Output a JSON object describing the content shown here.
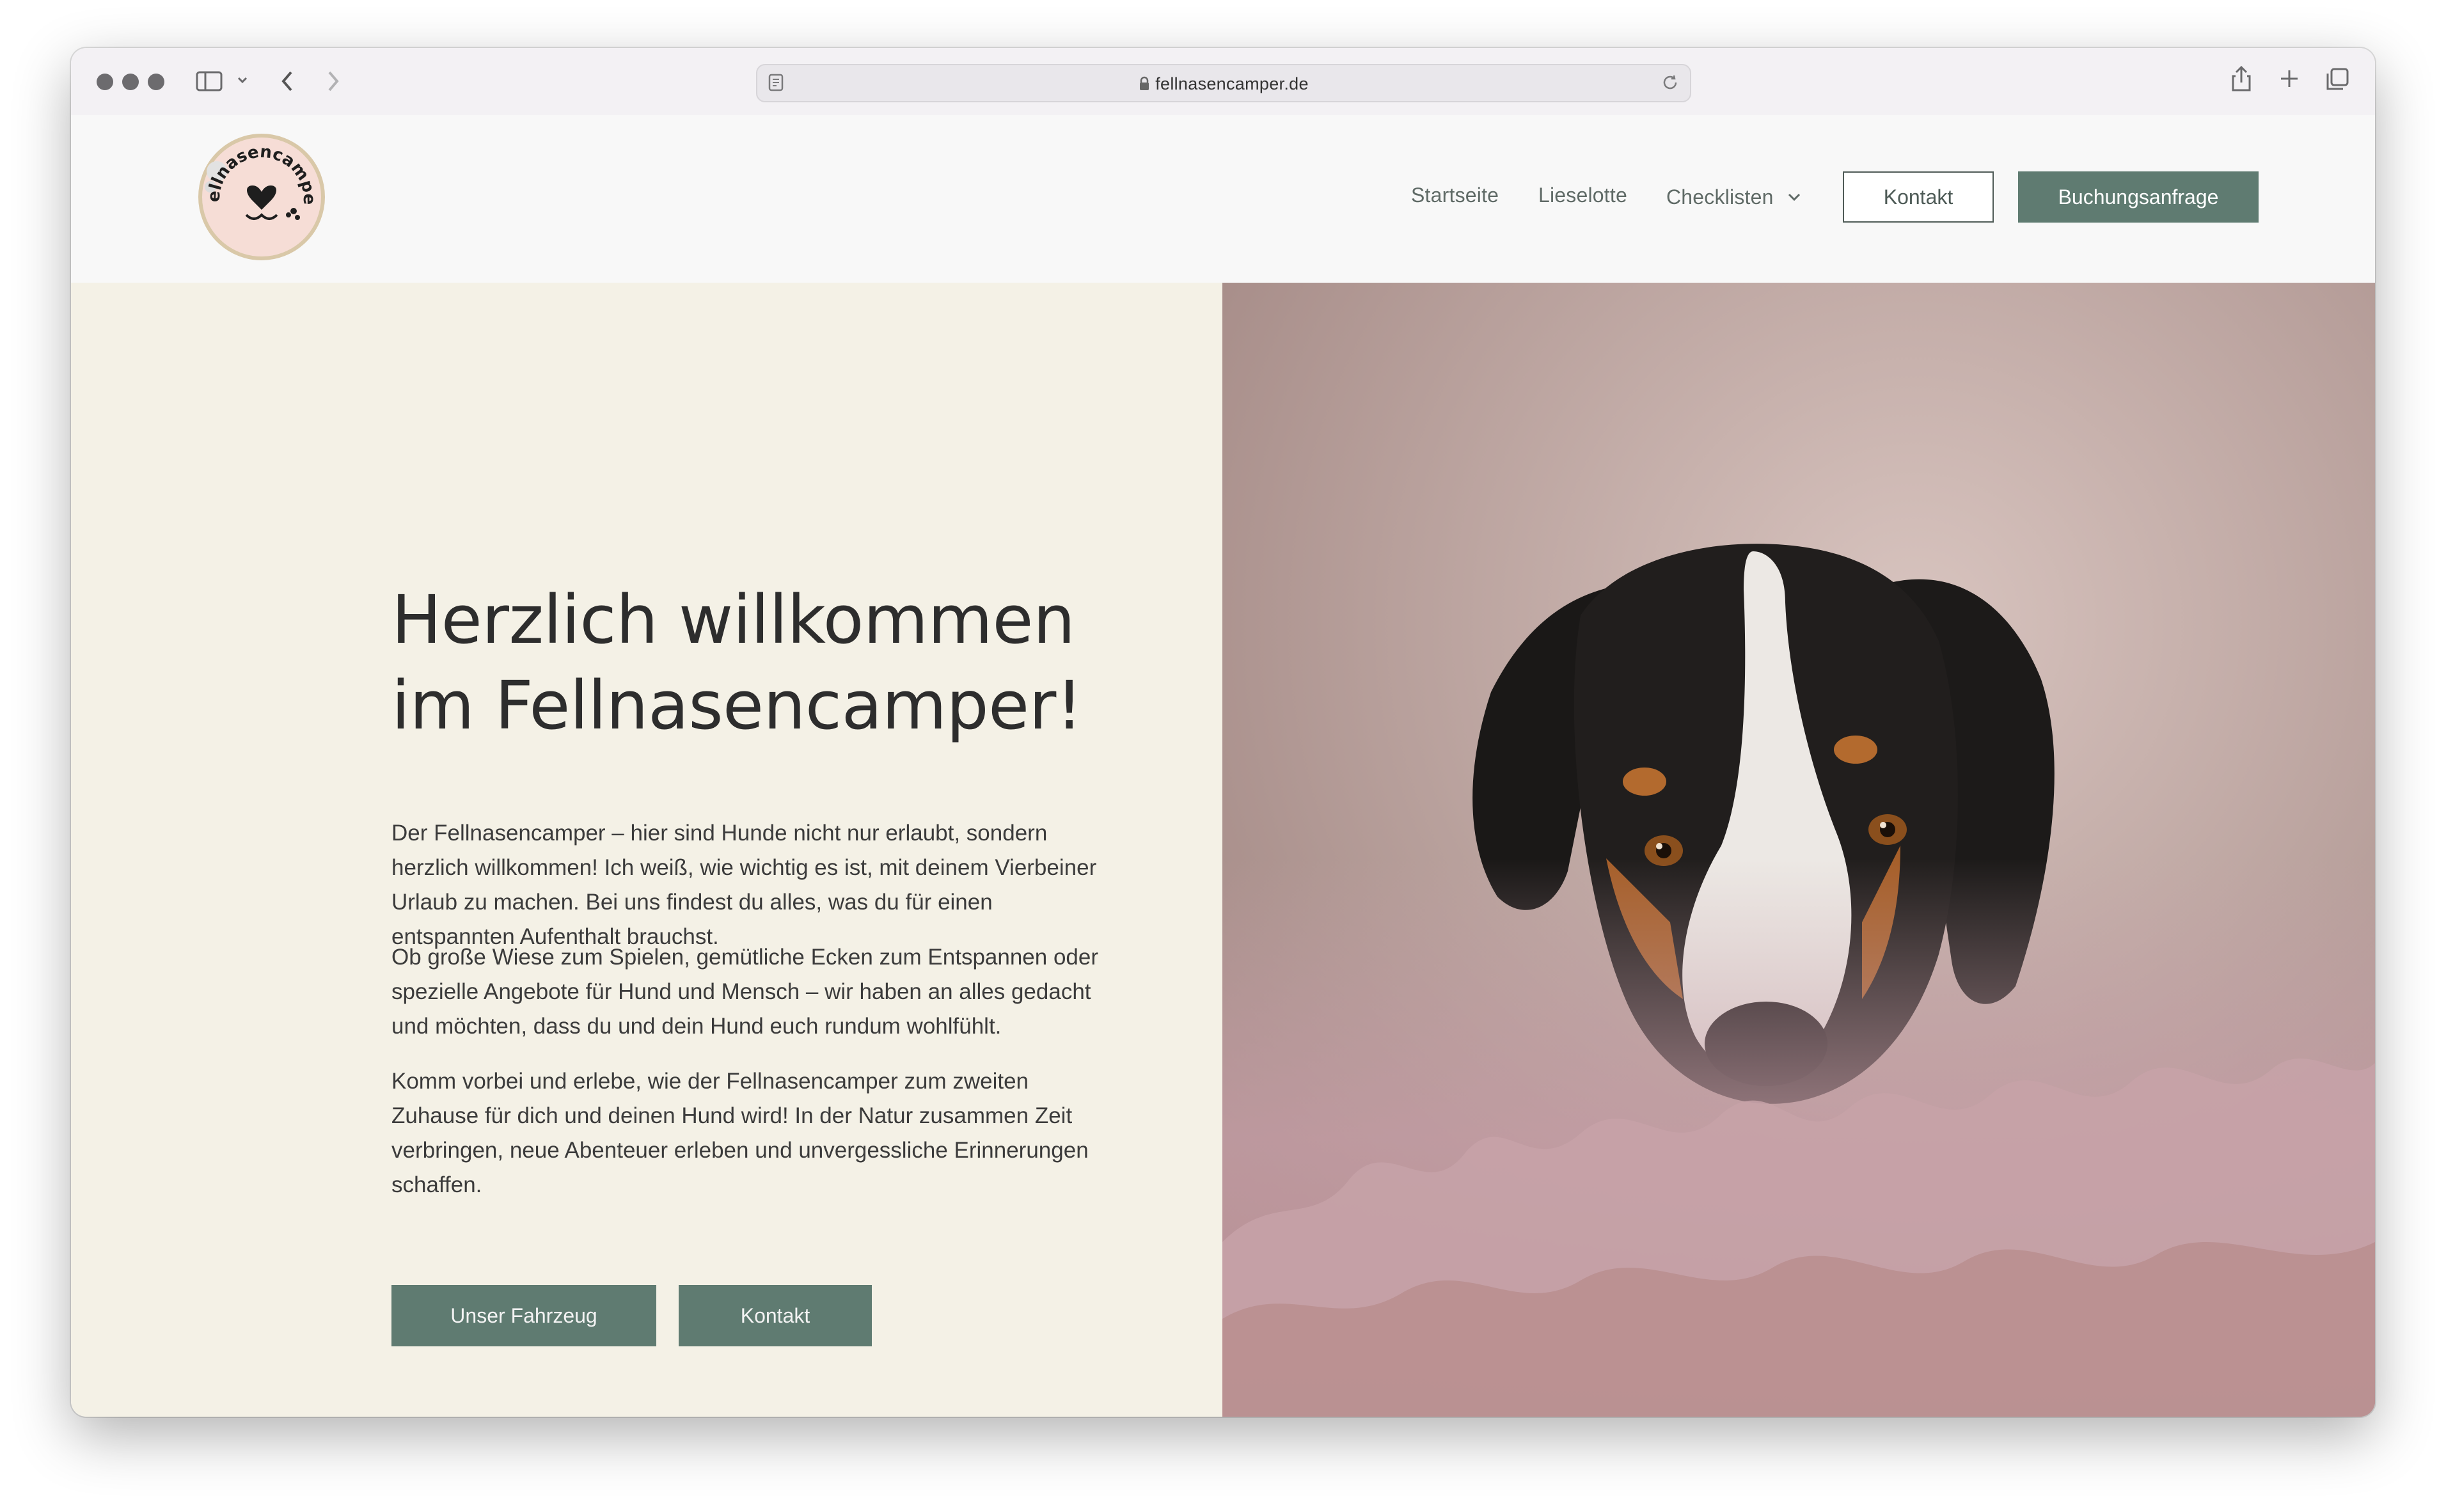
{
  "browser": {
    "url": "fellnasencamper.de"
  },
  "header": {
    "logo_text": "Fellnasencamper",
    "nav": [
      {
        "label": "Startseite"
      },
      {
        "label": "Lieselotte"
      },
      {
        "label": "Checklisten"
      }
    ],
    "contact_button": "Kontakt",
    "booking_button": "Buchungsanfrage"
  },
  "hero": {
    "title_line1": "Herzlich willkommen",
    "title_line2": "im Fellnasencamper!",
    "paragraphs": [
      "Der Fellnasencamper – hier sind Hunde nicht nur erlaubt, sondern herzlich willkommen! Ich weiß, wie wichtig es ist, mit deinem Vierbeiner Urlaub zu machen. Bei uns findest du alles, was du für einen entspannten Aufenthalt brauchst.",
      "Ob große Wiese zum Spielen, gemütliche Ecken zum Entspannen oder spezielle Angebote für Hund und Mensch – wir haben an alles gedacht und möchten, dass du und dein Hund euch rundum wohlfühlt.",
      "Komm vorbei und erlebe, wie der Fellnasencamper zum zweiten Zuhause für dich und deinen Hund wird! In der Natur zusammen Zeit verbringen, neue Abenteuer erleben und unvergessliche Erinnerungen schaffen."
    ],
    "button_vehicle": "Unser Fahrzeug",
    "button_contact": "Kontakt"
  },
  "colors": {
    "accent": "#5f7b71",
    "hero_bg": "#f4f1e6",
    "text": "#2d2d2d"
  }
}
